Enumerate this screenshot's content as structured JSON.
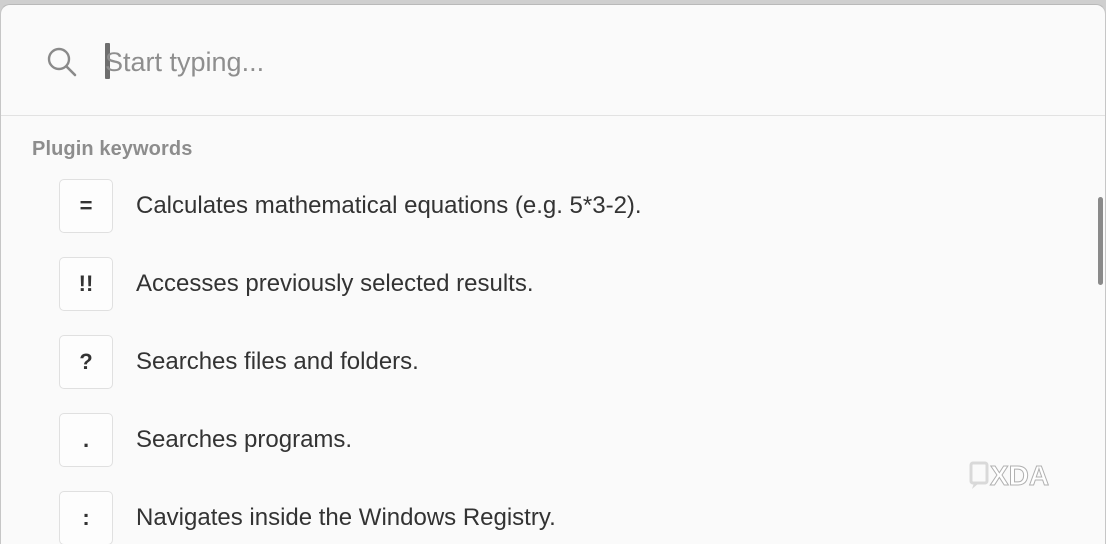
{
  "search": {
    "placeholder": "Start typing...",
    "value": ""
  },
  "section": {
    "title": "Plugin keywords"
  },
  "keywords": [
    {
      "key": "=",
      "description": "Calculates mathematical equations (e.g. 5*3-2)."
    },
    {
      "key": "!!",
      "description": "Accesses previously selected results."
    },
    {
      "key": "?",
      "description": "Searches files and folders."
    },
    {
      "key": ".",
      "description": "Searches programs."
    },
    {
      "key": ":",
      "description": "Navigates inside the Windows Registry."
    }
  ],
  "watermark": {
    "text": "XDA"
  },
  "colors": {
    "background": "#fafafa",
    "text": "#333333",
    "muted": "#8d8d8d",
    "border": "#e0e0e0"
  }
}
